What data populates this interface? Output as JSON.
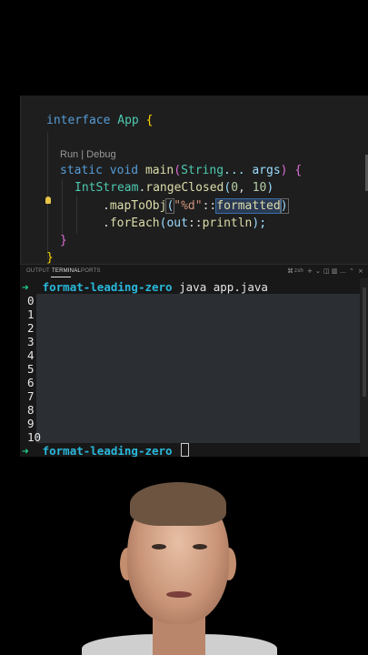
{
  "editor": {
    "line1": {
      "kw": "interface",
      "name": "App",
      "brace": "{"
    },
    "codelens": "Run | Debug",
    "line2": {
      "kw1": "static",
      "kw2": "void",
      "fn": "main",
      "open": "(",
      "type": "String",
      "rest": "... args",
      "close": ")",
      "brace": "{"
    },
    "line3": {
      "type": "IntStream",
      "dot": ".",
      "fn": "rangeClosed",
      "open": "(",
      "a": "0",
      "comma": ", ",
      "b": "10",
      "close": ")"
    },
    "line4": {
      "dot": ".",
      "fn": "mapToObj",
      "open": "(",
      "str": "\"%d\"",
      "sep": "::",
      "method": "formatted",
      "close": ")"
    },
    "line5": {
      "dot": ".",
      "fn": "forEach",
      "open": "(",
      "var": "out",
      "sep": "::",
      "method": "println",
      "close": ");"
    },
    "close_inner": "}",
    "close_outer": "}"
  },
  "panel_tabs": {
    "output": "OUTPUT",
    "terminal": "TERMINAL",
    "ports": "PORTS",
    "shell": "zsh"
  },
  "terminal": {
    "prompt_symbol": "➜",
    "directory": "format-leading-zero",
    "command": "java app.java",
    "output_lines": [
      "0",
      "1",
      "2",
      "3",
      "4",
      "5",
      "6",
      "7",
      "8",
      "9",
      "10"
    ]
  },
  "icons": [
    "lightbulb-icon",
    "shell-icon",
    "plus-icon",
    "chevron-down-icon",
    "split-icon",
    "trash-icon",
    "more-icon",
    "maximize-icon",
    "close-icon"
  ]
}
